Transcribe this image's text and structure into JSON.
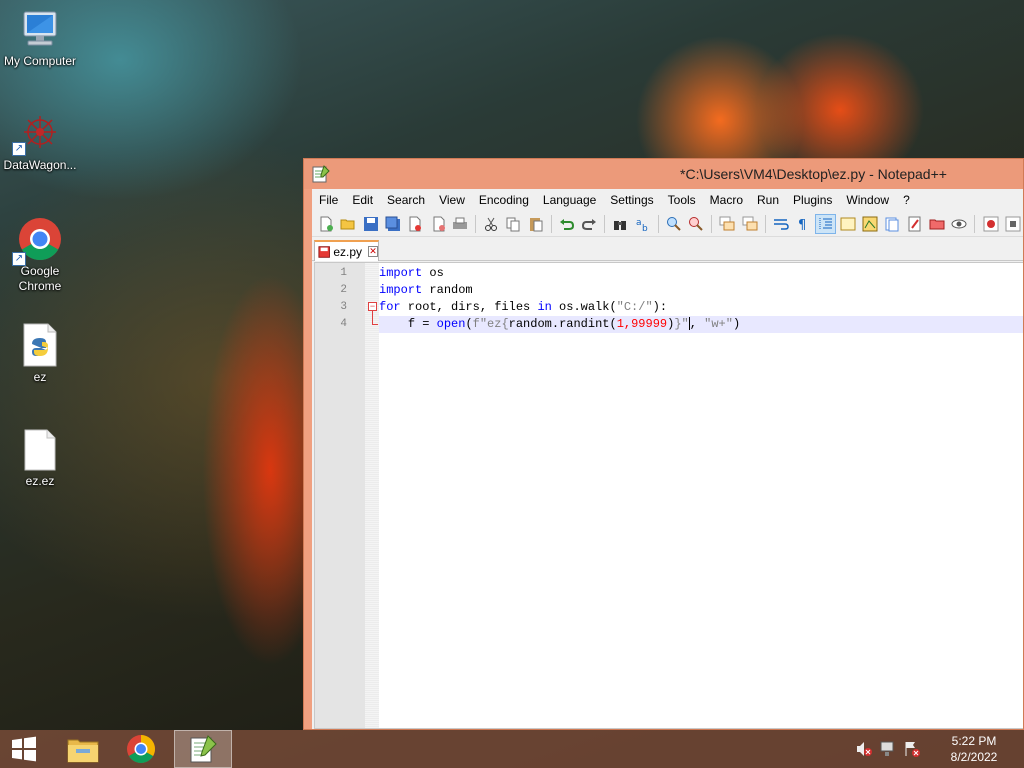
{
  "desktop": {
    "icons": [
      {
        "label": "My Computer"
      },
      {
        "label": "DataWagon..."
      },
      {
        "label": "Google Chrome"
      },
      {
        "label": "ez"
      },
      {
        "label": "ez.ez"
      }
    ]
  },
  "window": {
    "title": "*C:\\Users\\VM4\\Desktop\\ez.py - Notepad++",
    "menu": [
      "File",
      "Edit",
      "Search",
      "View",
      "Encoding",
      "Language",
      "Settings",
      "Tools",
      "Macro",
      "Run",
      "Plugins",
      "Window",
      "?"
    ],
    "tab": {
      "label": "ez.py"
    },
    "line_numbers": [
      "1",
      "2",
      "3",
      "4"
    ],
    "code": {
      "line1": {
        "kw": "import",
        "rest": " os"
      },
      "line2": {
        "kw": "import",
        "rest": " random"
      },
      "line3": {
        "kw1": "for",
        "mid1": " root, dirs, files ",
        "kw2": "in",
        "mid2": " os.walk(",
        "str": "\"C:/\"",
        "end": "):"
      },
      "line4": {
        "indent": "    ",
        "pre": "f = ",
        "fn": "open",
        "p1": "(",
        "str1": "f\"ez{",
        "call": "random.randint(",
        "num": "1,99999",
        "close": ")",
        "str2": "}\"",
        "sep": ", ",
        "str3": "\"w+\"",
        "end": ")"
      }
    }
  },
  "taskbar": {
    "clock_time": "5:22 PM",
    "clock_date": "8/2/2022"
  }
}
